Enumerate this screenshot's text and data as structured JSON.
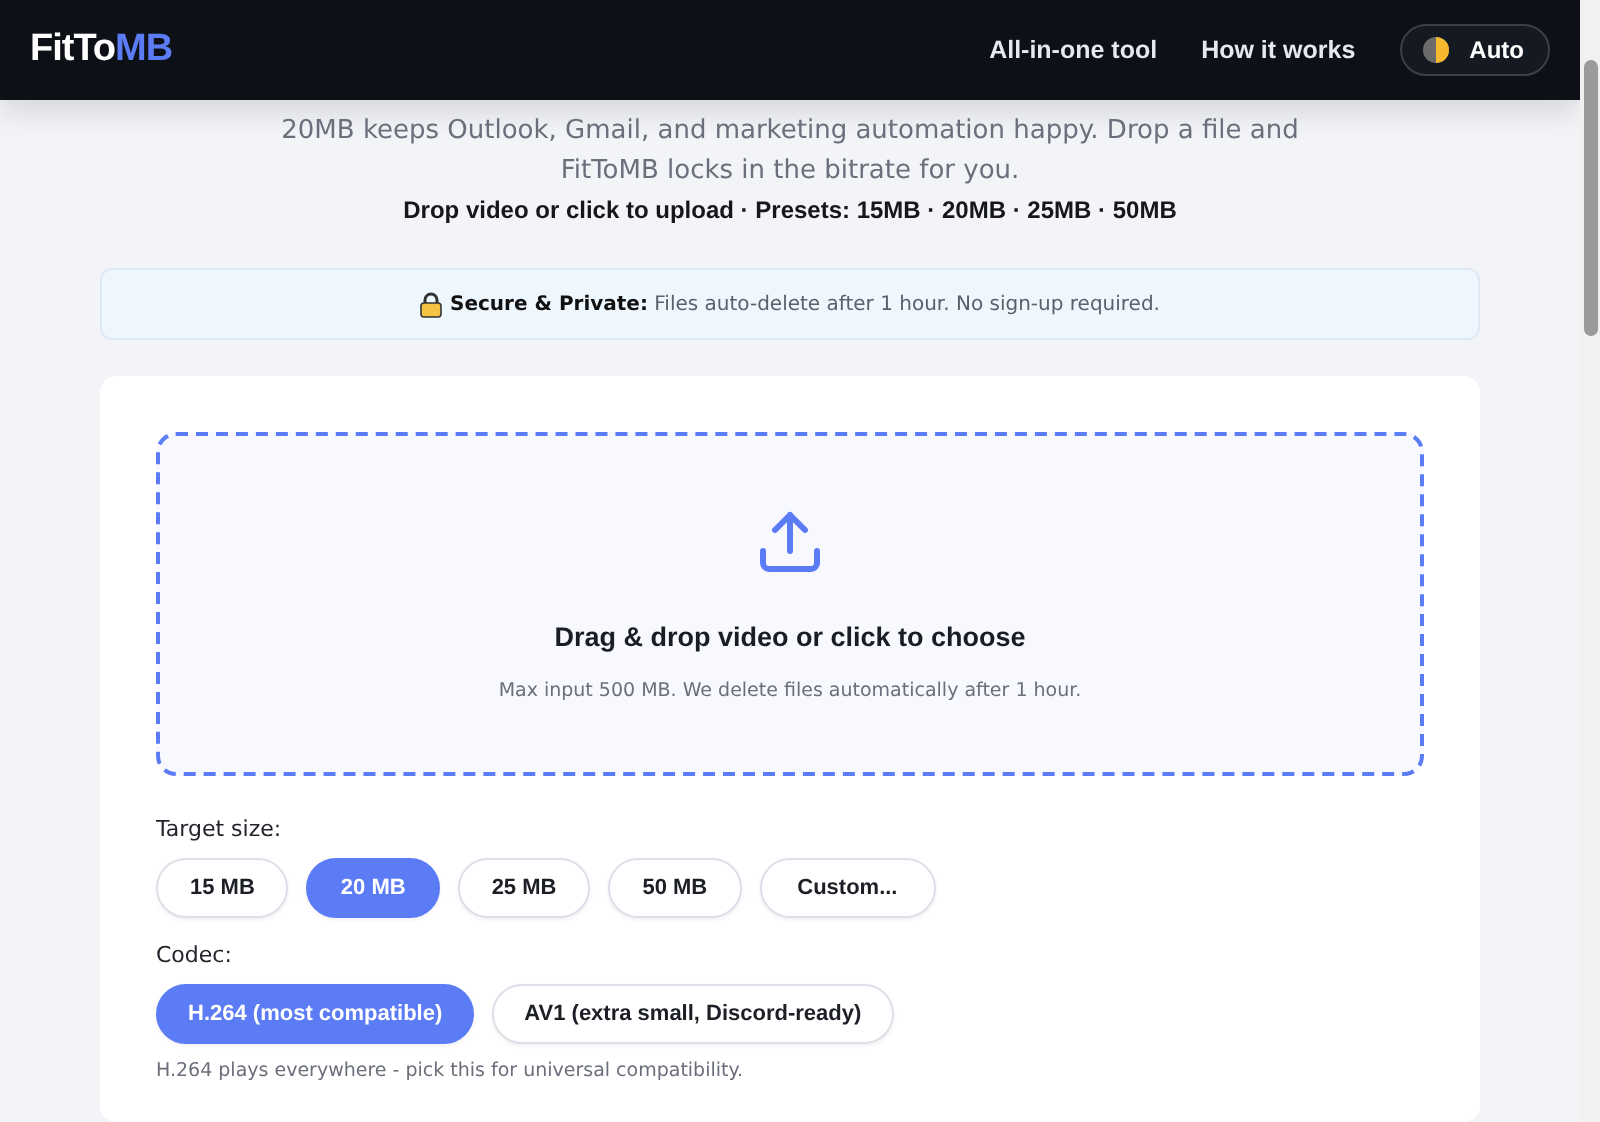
{
  "header": {
    "logo": {
      "part_1": "FitTo",
      "part_2": "MB"
    },
    "nav": [
      "All-in-one tool",
      "How it works"
    ],
    "theme_button": "Auto"
  },
  "intro": {
    "text": "20MB keeps Outlook, Gmail, and marketing automation happy. Drop a file and FitToMB locks in the bitrate for you.",
    "hint": "Drop video or click to upload · Presets: 15MB · 20MB · 25MB · 50MB"
  },
  "notice": "**Secure & Private:** Files auto-delete after 1 hour. No sign-up required.",
  "dropzone": {
    "title": "Drag & drop video or click to choose",
    "subtitle": "Max input 500 MB. We delete files automatically after 1 hour."
  },
  "target_size": {
    "label": "Target size:",
    "options": [
      {
        "label": "15 MB",
        "selected": false
      },
      {
        "label": "20 MB",
        "selected": true
      },
      {
        "label": "25 MB",
        "selected": false
      },
      {
        "label": "50 MB",
        "selected": false
      },
      {
        "label": "Custom...",
        "selected": false
      }
    ]
  },
  "codec": {
    "label": "Codec:",
    "options": [
      {
        "label": "H.264 (most compatible)",
        "selected": true
      },
      {
        "label": "AV1 (extra small, Discord-ready)",
        "selected": false
      }
    ],
    "hint": "H.264 plays everywhere - pick this for universal compatibility."
  }
}
